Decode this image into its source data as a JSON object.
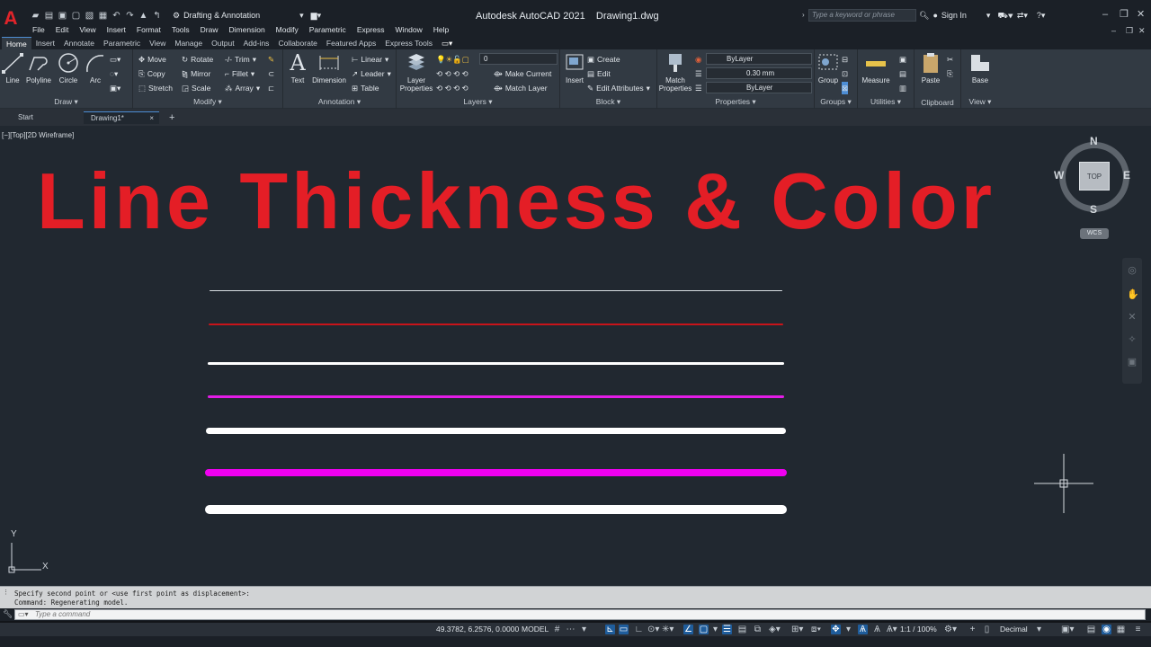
{
  "app": {
    "title": "Autodesk AutoCAD 2021    Drawing1.dwg",
    "logo_letter": "A",
    "workspace": "Drafting & Annotation",
    "search_placeholder": "Type a keyword or phrase",
    "signin_label": "Sign In"
  },
  "menu": [
    "File",
    "Edit",
    "View",
    "Insert",
    "Format",
    "Tools",
    "Draw",
    "Dimension",
    "Modify",
    "Parametric",
    "Express",
    "Window",
    "Help"
  ],
  "ribbon_tabs": [
    "Home",
    "Insert",
    "Annotate",
    "Parametric",
    "View",
    "Manage",
    "Output",
    "Add-ins",
    "Collaborate",
    "Featured Apps",
    "Express Tools"
  ],
  "ribbon": {
    "draw": {
      "title": "Draw ▾",
      "line": "Line",
      "polyline": "Polyline",
      "circle": "Circle",
      "arc": "Arc"
    },
    "modify": {
      "title": "Modify ▾",
      "move": "Move",
      "rotate": "Rotate",
      "trim": "Trim",
      "copy": "Copy",
      "mirror": "Mirror",
      "fillet": "Fillet",
      "stretch": "Stretch",
      "scale": "Scale",
      "array": "Array"
    },
    "annotation": {
      "title": "Annotation ▾",
      "text": "Text",
      "dimension": "Dimension",
      "linear": "Linear",
      "leader": "Leader",
      "table": "Table"
    },
    "layers": {
      "title": "Layers ▾",
      "layer_properties_1": "Layer",
      "layer_properties_2": "Properties",
      "current_layer": "0",
      "make_current": "Make Current",
      "match_layer": "Match Layer"
    },
    "block": {
      "title": "Block ▾",
      "insert": "Insert",
      "create": "Create",
      "edit": "Edit",
      "edit_attributes": "Edit Attributes"
    },
    "properties": {
      "title": "Properties ▾",
      "match_1": "Match",
      "match_2": "Properties",
      "color": "ByLayer",
      "lineweight": "0.30 mm",
      "linetype": "ByLayer"
    },
    "groups": {
      "title": "Groups ▾",
      "group": "Group"
    },
    "utilities": {
      "title": "Utilities ▾",
      "measure": "Measure"
    },
    "clipboard": {
      "title": "Clipboard",
      "paste": "Paste"
    },
    "view": {
      "title": "View ▾",
      "base": "Base"
    }
  },
  "file_tabs": {
    "start": "Start",
    "drawing": "Drawing1*",
    "close": "×",
    "add": "+"
  },
  "canvas": {
    "viewport_label": "[−][Top][2D Wireframe]",
    "banner": "Line Thickness & Color",
    "lines": [
      {
        "color": "#d8dde2",
        "weight": "thin"
      },
      {
        "color": "#c8141a",
        "weight": "thin"
      },
      {
        "color": "#ffffff",
        "weight": "medium"
      },
      {
        "color": "#e31ce6",
        "weight": "medium"
      },
      {
        "color": "#ffffff",
        "weight": "thick"
      },
      {
        "color": "#f000f0",
        "weight": "thick"
      },
      {
        "color": "#ffffff",
        "weight": "heavy"
      }
    ],
    "ucs_x": "X",
    "ucs_y": "Y"
  },
  "viewcube": {
    "n": "N",
    "s": "S",
    "e": "E",
    "w": "W",
    "face": "TOP",
    "wcs": "WCS"
  },
  "command": {
    "history": [
      "Specify second point or <use first point as displacement>:",
      "Command: Regenerating model."
    ],
    "placeholder": "Type a command"
  },
  "status": {
    "coords": "49.3782, 6.2576, 0.0000",
    "space": "MODEL",
    "scale": "1:1 / 100%",
    "units": "Decimal"
  },
  "colors": {
    "accent": "#4d8dd4",
    "banner": "#e41e26",
    "canvas": "#212830"
  }
}
